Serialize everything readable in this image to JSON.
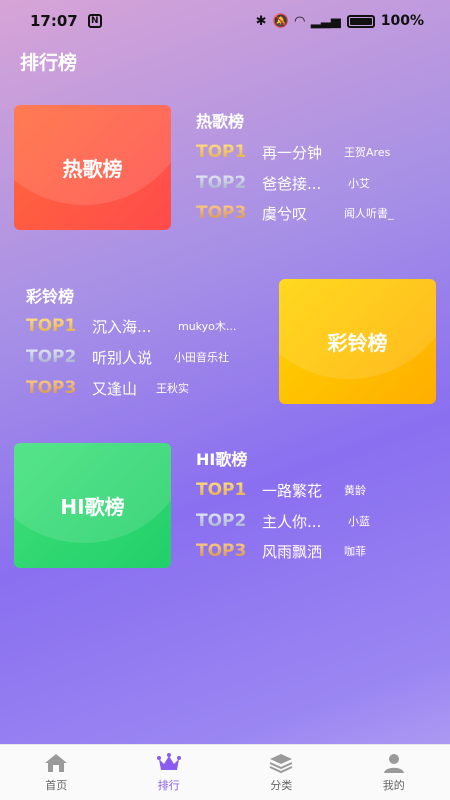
{
  "status_bar": {
    "time": "17:07",
    "battery": "100%"
  },
  "page": {
    "title": "排行榜"
  },
  "charts": [
    {
      "cover_label": "热歌榜",
      "title": "热歌榜",
      "rows": [
        {
          "rank": "TOP1",
          "song": "再一分钟",
          "singer": "王贺Ares"
        },
        {
          "rank": "TOP2",
          "song": "爸爸接...",
          "singer": "小艾"
        },
        {
          "rank": "TOP3",
          "song": "虞兮叹",
          "singer": "闻人听書_"
        }
      ]
    },
    {
      "cover_label": "彩铃榜",
      "title": "彩铃榜",
      "rows": [
        {
          "rank": "TOP1",
          "song": "沉入海...",
          "singer": "mukyo木..."
        },
        {
          "rank": "TOP2",
          "song": "听别人说",
          "singer": "小田音乐社"
        },
        {
          "rank": "TOP3",
          "song": "又逢山",
          "singer": "王秋实"
        }
      ]
    },
    {
      "cover_label": "HI歌榜",
      "title": "HI歌榜",
      "rows": [
        {
          "rank": "TOP1",
          "song": "一路繁花",
          "singer": "黄龄"
        },
        {
          "rank": "TOP2",
          "song": "主人你...",
          "singer": "小蓝"
        },
        {
          "rank": "TOP3",
          "song": "风雨飘洒",
          "singer": "咖菲"
        }
      ]
    }
  ],
  "tabbar": {
    "home": "首页",
    "rank": "排行",
    "category": "分类",
    "mine": "我的",
    "active_color": "#8a5cf0"
  }
}
